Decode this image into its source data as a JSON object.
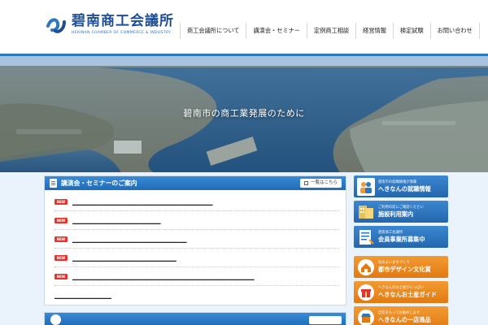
{
  "header": {
    "logo_title": "碧南商工会議所",
    "logo_sub": "HEKINAN CHAMBER OF COMMERCE & INDUSTRY",
    "brand_color": "#1e4f93"
  },
  "nav": [
    {
      "label": "商工会議所について"
    },
    {
      "label": "講演会・セミナー"
    },
    {
      "label": "定例商工相談"
    },
    {
      "label": "経営情報"
    },
    {
      "label": "検定試験"
    },
    {
      "label": "お問い合わせ"
    }
  ],
  "hero": {
    "caption": "碧南市の商工業発展のために"
  },
  "seminar_panel": {
    "title": "講演会・セミナーのご案内",
    "list_button": "一覧はこちら",
    "new_label": "NEW",
    "items": [
      {
        "text": "＿＿＿＿＿＿＿＿＿＿＿＿＿＿＿＿＿＿＿＿＿＿＿＿＿＿＿",
        "is_new": true
      },
      {
        "text": "＿＿＿＿＿＿＿＿＿＿＿＿＿＿＿＿＿",
        "is_new": true
      },
      {
        "text": "＿＿＿＿＿＿＿＿＿＿＿＿＿＿＿＿＿＿＿＿＿＿",
        "is_new": true
      },
      {
        "text": "＿＿＿＿＿＿＿＿＿＿＿＿＿＿＿＿＿＿＿＿",
        "is_new": true
      },
      {
        "text": "＿＿＿＿＿＿＿＿＿＿＿＿＿＿＿＿＿＿＿＿＿＿＿＿＿＿＿＿＿＿＿＿＿＿＿",
        "is_new": true
      },
      {
        "text": "＿＿＿＿＿＿＿＿＿＿＿",
        "is_new": false
      }
    ]
  },
  "sidebar": {
    "banners": [
      {
        "small": "碧南市の就職情報が満載",
        "big": "へきなんの就職情報",
        "color": "blue",
        "icon": "people-icon"
      },
      {
        "small": "ご利用の前にご確認ください",
        "big": "施設利用案内",
        "color": "blue",
        "icon": "building-icon"
      },
      {
        "small": "碧南商工会議所",
        "big": "会員事業所募集中",
        "color": "blue",
        "icon": "document-icon"
      },
      {
        "small": "住みよいまちづくり",
        "big": "都市デザイン文化賞",
        "color": "orange",
        "icon": "house-icon"
      },
      {
        "small": "へきなんのお土産がいっぱい",
        "big": "へきなんお土産ガイド",
        "color": "orange",
        "icon": "gift-icon"
      },
      {
        "small": "自信をもってお勧めします",
        "big": "へきなんの一店逸品",
        "color": "orange",
        "icon": "shop-icon"
      }
    ]
  },
  "colors": {
    "accent_blue": "#2a78c2",
    "new_badge": "#e8322b",
    "orange": "#f29a32"
  }
}
